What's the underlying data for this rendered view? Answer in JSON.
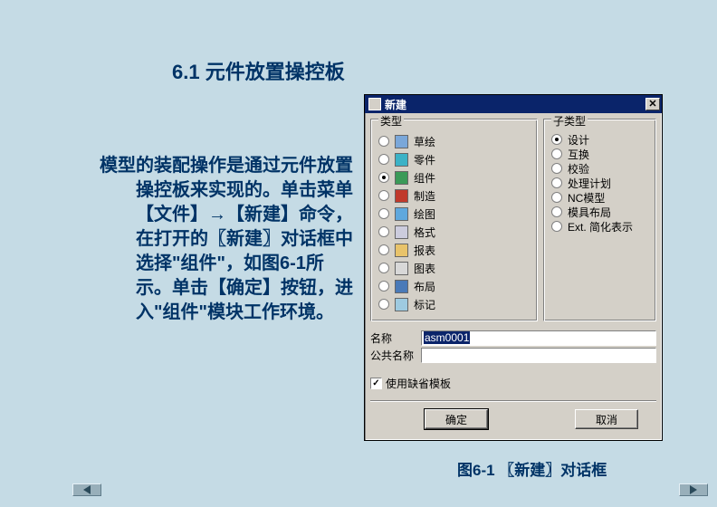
{
  "slide": {
    "title": "6.1  元件放置操控板",
    "body": "模型的装配操作是通过元件放置操控板来实现的。单击菜单【文件】→【新建】命令，在打开的〖新建〗对话框中选择\"组件\"，如图6-1所示。单击【确定】按钮，进入\"组件\"模块工作环境。",
    "caption": "图6-1 〖新建〗对话框"
  },
  "dialog": {
    "title": "新建",
    "types_group": "类型",
    "subtypes_group": "子类型",
    "types": [
      {
        "label": "草绘",
        "selected": false,
        "icon_color": "#7aa7d9"
      },
      {
        "label": "零件",
        "selected": false,
        "icon_color": "#3bb2c6"
      },
      {
        "label": "组件",
        "selected": true,
        "icon_color": "#3a9a58"
      },
      {
        "label": "制造",
        "selected": false,
        "icon_color": "#c0392b"
      },
      {
        "label": "绘图",
        "selected": false,
        "icon_color": "#5fa8dd"
      },
      {
        "label": "格式",
        "selected": false,
        "icon_color": "#ccccdd"
      },
      {
        "label": "报表",
        "selected": false,
        "icon_color": "#e8c36a"
      },
      {
        "label": "图表",
        "selected": false,
        "icon_color": "#d8d8d8"
      },
      {
        "label": "布局",
        "selected": false,
        "icon_color": "#4a7ab8"
      },
      {
        "label": "标记",
        "selected": false,
        "icon_color": "#9ecae0"
      }
    ],
    "subtypes": [
      {
        "label": "设计",
        "selected": true
      },
      {
        "label": "互换",
        "selected": false
      },
      {
        "label": "校验",
        "selected": false
      },
      {
        "label": "处理计划",
        "selected": false
      },
      {
        "label": "NC模型",
        "selected": false
      },
      {
        "label": "模具布局",
        "selected": false
      },
      {
        "label": "Ext. 简化表示",
        "selected": false
      }
    ],
    "name_label": "名称",
    "name_value": "asm0001",
    "common_name_label": "公共名称",
    "common_name_value": "",
    "use_default_template": "使用缺省模板",
    "ok": "确定",
    "cancel": "取消"
  }
}
